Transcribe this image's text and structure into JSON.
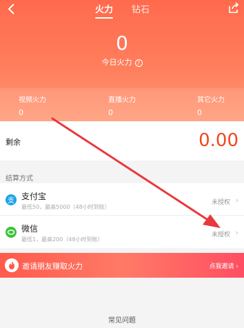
{
  "nav": {
    "tabs": [
      {
        "label": "火力",
        "active": true
      },
      {
        "label": "钻石",
        "active": false
      }
    ],
    "back_icon": "chevron-left-icon",
    "share_icon": "share-icon"
  },
  "summary": {
    "today_value": "0",
    "today_label": "今日火力",
    "help_glyph": "?"
  },
  "stats": [
    {
      "label": "视频火力",
      "value": "0"
    },
    {
      "label": "直播火力",
      "value": "0"
    },
    {
      "label": "其它火力",
      "value": "0"
    }
  ],
  "remaining": {
    "label": "剩余",
    "value": "0.00"
  },
  "settlement": {
    "title": "结算方式",
    "methods": [
      {
        "name": "支付宝",
        "desc": "最低50，最高5000（48小时到账）",
        "status": "未授权",
        "icon": "alipay-icon",
        "icon_glyph": "支"
      },
      {
        "name": "微信",
        "desc": "最低1，最高200（48小时到账）",
        "status": "未授权",
        "icon": "wechat-icon"
      }
    ]
  },
  "invite": {
    "text": "邀请朋友赚取火力",
    "action": "点我邀请",
    "icon": "flame-icon"
  },
  "footer": {
    "faq_label": "常见问题"
  },
  "colors": {
    "accent": "#ff6a4d",
    "amount": "#f2461e",
    "alipay": "#1aa3e8",
    "wechat": "#3cc33c",
    "annotation_arrow": "#e8383d"
  },
  "annotation": {
    "type": "red-arrow",
    "points_to": "wechat authorization status"
  }
}
